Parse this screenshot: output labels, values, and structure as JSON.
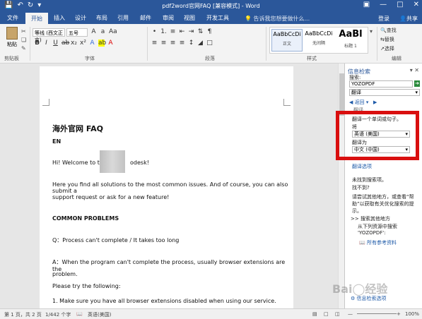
{
  "titlebar": {
    "title": "pdf2word官网FAQ [兼容模式] - Word",
    "save_icon": "save-icon",
    "undo_icon": "undo-icon",
    "redo_icon": "redo-icon"
  },
  "tabs": [
    "文件",
    "开始",
    "插入",
    "设计",
    "布局",
    "引用",
    "邮件",
    "审阅",
    "视图",
    "开发工具"
  ],
  "tellme": "告诉我您想要做什么...",
  "signin": "登录",
  "share": "共享",
  "ribbon": {
    "paste_label": "粘贴",
    "font_name": "等线 (西文正文)",
    "font_size": "五号",
    "clipboard_label": "剪贴板",
    "font_label": "字体",
    "paragraph_label": "段落",
    "styles_label": "样式",
    "editing_label": "编辑",
    "styles": [
      {
        "sample": "AaBbCcDi",
        "name": "正文"
      },
      {
        "sample": "AaBbCcDi",
        "name": "无间隔"
      },
      {
        "sample": "AaBl",
        "name": "标题 1"
      }
    ],
    "find": "查找",
    "replace": "替换",
    "select": "选择"
  },
  "document": {
    "title": "海外官网 FAQ",
    "en": "EN",
    "welcome_a": "Hi! Welcome to the",
    "welcome_b": "odesk!",
    "para1": "Here you find all solutions to the most common issues. And of course, you can also submit a",
    "para1b": "support request or ask for a new feature!",
    "heading": "COMMON PROBLEMS",
    "q1": "Q：Process can't complete / It takes too long",
    "a1": "A：When the program can't complete the process, usually browser extensions are the",
    "a1b": "problem.",
    "try": "Please try the following:",
    "step1": "1. Make sure you have all browser extensions disabled when using our service."
  },
  "pane": {
    "title": "信息检索",
    "search_label": "搜索:",
    "search_value": "YOZOPDF",
    "service": "翻译",
    "back": "返回",
    "section": "翻译",
    "translate_phrase": "翻译一个单词或句子。",
    "from_label": "将",
    "from_value": "英语 (美国)",
    "to_label": "翻译为",
    "to_value": "中文 (中国)",
    "options": "翻译选项",
    "no_results": "未找到搜索项。",
    "not_found": "找不到?",
    "hint": "请尝试其他地方，或查看“帮助”以获取有关优化搜索的提示。",
    "search_other": "搜索其他地方",
    "from_resources": "从下列资源中搜索",
    "query": "'YOZOPDF':",
    "all_refs": "所有参考资料",
    "get_more": "信息检索选项"
  },
  "status": {
    "page": "第 1 页，共 2 页",
    "words": "1/442 个字",
    "lang": "英语(美国)",
    "zoom": "100%"
  }
}
